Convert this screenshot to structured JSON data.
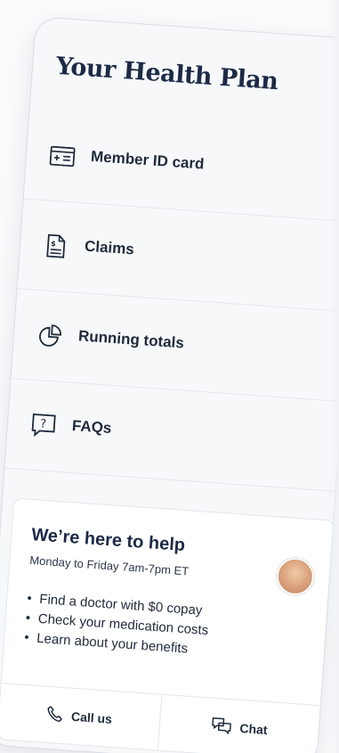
{
  "header": {
    "title": "Your Health Plan"
  },
  "menu": {
    "items": [
      {
        "label": "Member ID card",
        "icon": "id-card-icon"
      },
      {
        "label": "Claims",
        "icon": "claims-document-icon"
      },
      {
        "label": "Running totals",
        "icon": "pie-chart-icon"
      },
      {
        "label": "FAQs",
        "icon": "question-bubble-icon"
      }
    ]
  },
  "help": {
    "title": "We’re here to help",
    "hours": "Monday to Friday 7am-7pm ET",
    "bullets": [
      "Find a doctor with $0 copay",
      "Check your medication costs",
      "Learn about your benefits"
    ],
    "call_label": "Call us",
    "chat_label": "Chat"
  },
  "colors": {
    "title": "#1c2a46",
    "text": "#1f2a3a",
    "divider": "#e3e6ea",
    "panel_bg": "#f7f8fa"
  }
}
